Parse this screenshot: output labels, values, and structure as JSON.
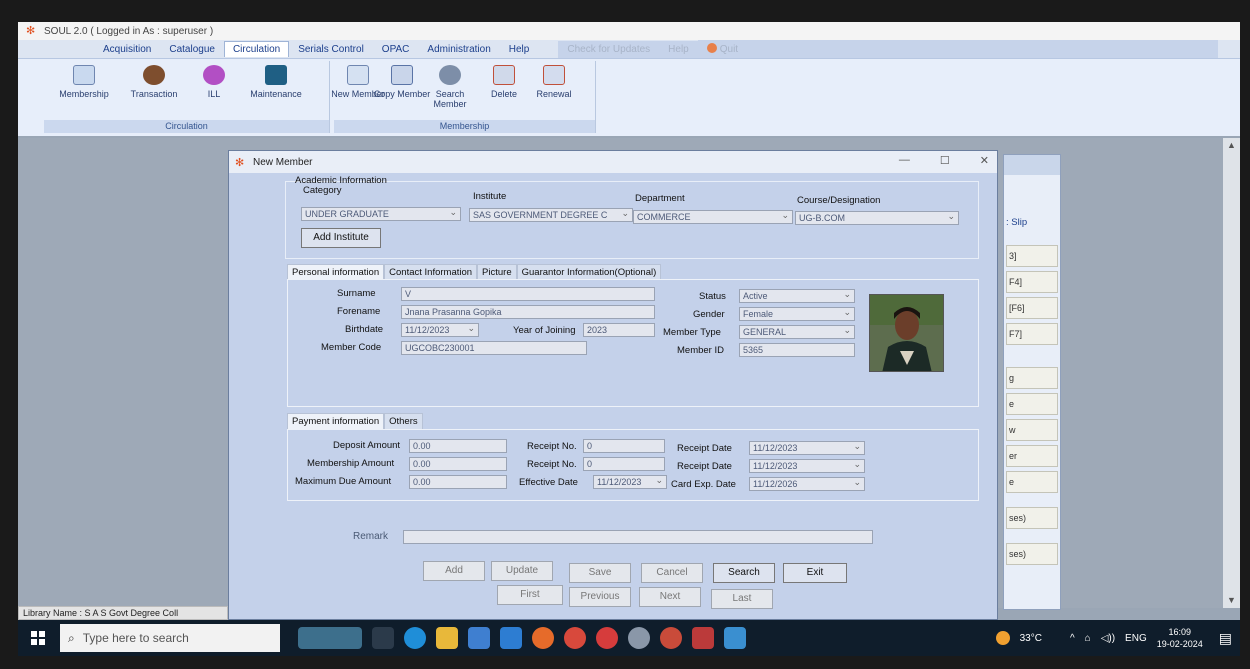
{
  "app": {
    "title": "SOUL 2.0 ( Logged in As : superuser )"
  },
  "menu": {
    "items": [
      "Acquisition",
      "Catalogue",
      "Circulation",
      "Serials Control",
      "OPAC",
      "Administration",
      "Help"
    ],
    "check_updates": "Check for Updates",
    "help": "Help",
    "quit": "Quit"
  },
  "ribbon": {
    "circulation_group": "Circulation",
    "membership_group": "Membership",
    "buttons": [
      "Membership",
      "Transaction",
      "ILL",
      "Maintenance",
      "New Member",
      "Copy Member",
      "Search Member",
      "Delete",
      "Renewal"
    ]
  },
  "dialog": {
    "title": "New Member",
    "academic": {
      "heading": "Academic Information",
      "category_label": "Category",
      "category_value": "UNDER GRADUATE",
      "institute_label": "Institute",
      "institute_value": "SAS GOVERNMENT DEGREE C",
      "department_label": "Department",
      "department_value": "COMMERCE",
      "course_label": "Course/Designation",
      "course_value": "UG-B.COM",
      "add_institute": "Add Institute"
    },
    "tabs": [
      "Personal information",
      "Contact Information",
      "Picture",
      "Guarantor Information(Optional)"
    ],
    "personal": {
      "surname_label": "Surname",
      "surname": "V",
      "forename_label": "Forename",
      "forename": "Jnana Prasanna Gopika",
      "birthdate_label": "Birthdate",
      "birthdate": "11/12/2023",
      "year_label": "Year of Joining",
      "year": "2023",
      "member_code_label": "Member Code",
      "member_code": "UGCOBC230001",
      "status_label": "Status",
      "status": "Active",
      "gender_label": "Gender",
      "gender": "Female",
      "member_type_label": "Member Type",
      "member_type": "GENERAL",
      "member_id_label": "Member ID",
      "member_id": "5365"
    },
    "payment_tabs": [
      "Payment information",
      "Others"
    ],
    "payment": {
      "deposit_label": "Deposit Amount",
      "deposit": "0.00",
      "membership_label": "Membership Amount",
      "membership": "0.00",
      "max_due_label": "Maximum Due Amount",
      "max_due": "0.00",
      "receipt1_label": "Receipt No.",
      "receipt1": "0",
      "receipt2_label": "Receipt No.",
      "receipt2": "0",
      "effective_label": "Effective Date",
      "effective": "11/12/2023",
      "receipt_date1_label": "Receipt Date",
      "receipt_date1": "11/12/2023",
      "receipt_date2_label": "Receipt Date",
      "receipt_date2": "11/12/2023",
      "card_exp_label": "Card Exp. Date",
      "card_exp": "11/12/2026"
    },
    "remark_label": "Remark",
    "buttons": {
      "add": "Add",
      "update": "Update",
      "save": "Save",
      "cancel": "Cancel",
      "search": "Search",
      "exit": "Exit",
      "first": "First",
      "previous": "Previous",
      "next": "Next",
      "last": "Last"
    }
  },
  "bg_window": {
    "items": [
      ": Slip",
      "3]",
      "F4]",
      "[F6]",
      "F7]",
      "g",
      "e",
      "w",
      "er",
      "e",
      "ses)",
      "ses)"
    ]
  },
  "status_bar": "Library Name : S A S Govt Degree Coll",
  "taskbar": {
    "search_placeholder": "Type here to search",
    "temperature": "33°C",
    "language": "ENG",
    "time": "16:09",
    "date": "19-02-2024"
  }
}
